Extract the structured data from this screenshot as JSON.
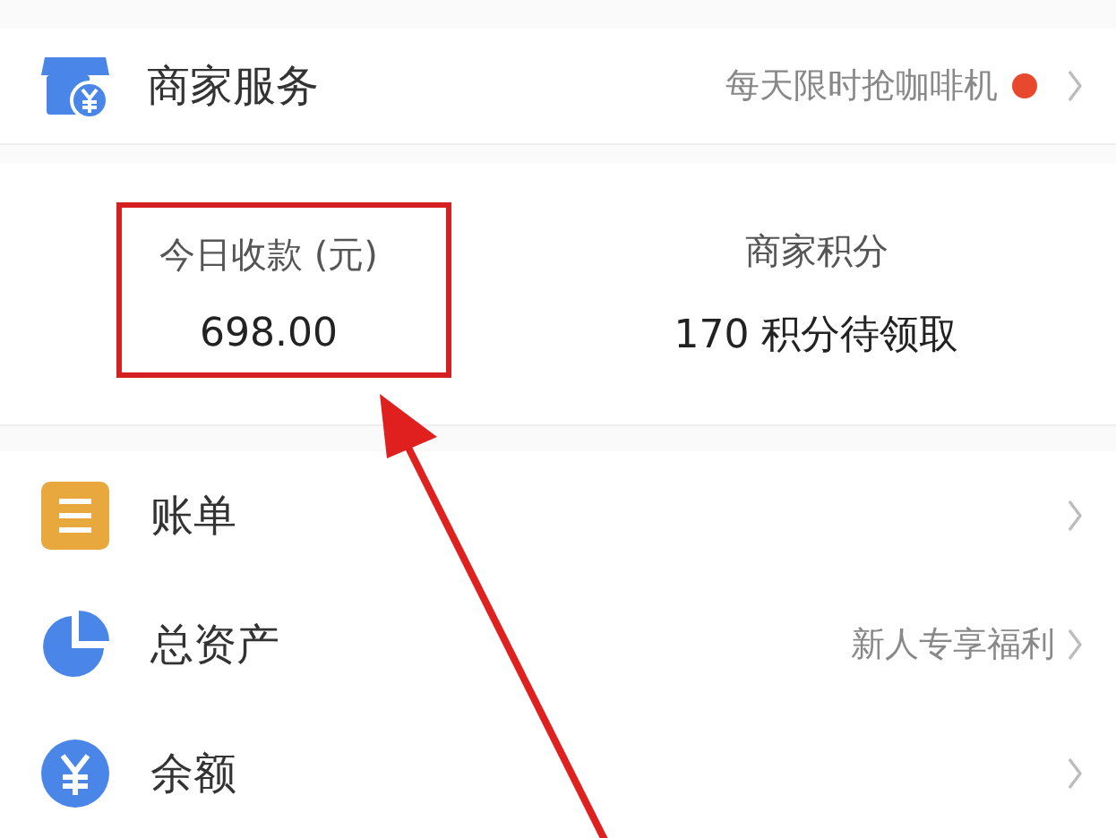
{
  "merchant_service": {
    "title": "商家服务",
    "promo": "每天限时抢咖啡机",
    "unread_dot": true
  },
  "stats": [
    {
      "label": "今日收款 (元)",
      "value": "698.00",
      "highlighted": true
    },
    {
      "label": "商家积分",
      "value": "170 积分待领取",
      "highlighted": false
    }
  ],
  "menu": [
    {
      "kind": "bill",
      "label": "账单"
    },
    {
      "kind": "assets",
      "label": "总资产",
      "hint": "新人专享福利"
    },
    {
      "kind": "balance",
      "label": "余额"
    }
  ]
}
